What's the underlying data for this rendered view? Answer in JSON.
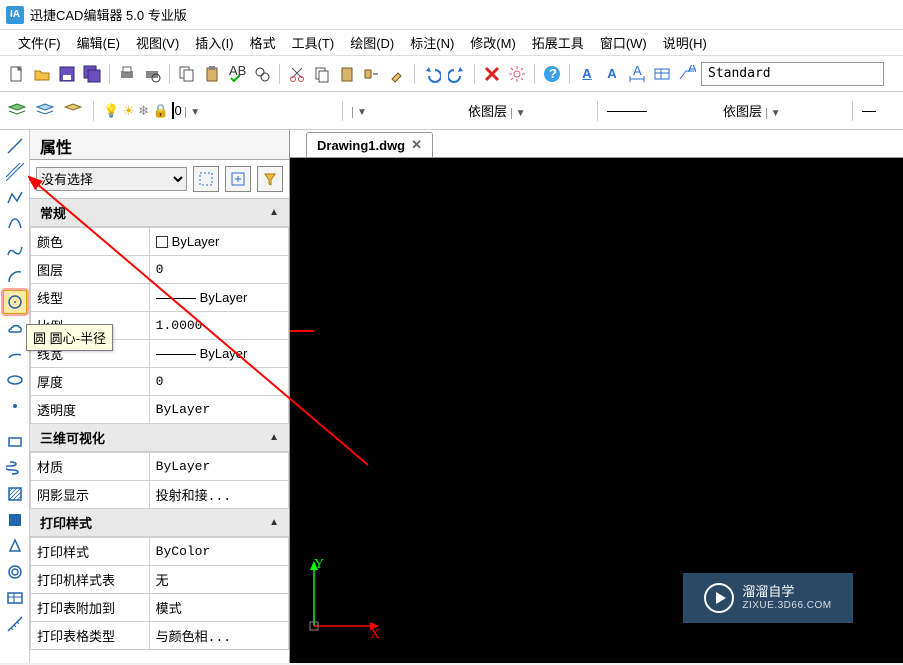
{
  "app": {
    "title": "迅捷CAD编辑器 5.0 专业版",
    "icon_text": "IA"
  },
  "menu": {
    "file": "文件(F)",
    "edit": "编辑(E)",
    "view": "视图(V)",
    "insert": "插入(I)",
    "format": "格式",
    "tools": "工具(T)",
    "draw": "绘图(D)",
    "dim": "标注(N)",
    "modify": "修改(M)",
    "ext": "拓展工具",
    "window": "窗口(W)",
    "help": "说明(H)"
  },
  "style_input": "Standard",
  "layer_row": {
    "layer_value": "0",
    "color_combo": "依图层",
    "linetype_combo": "依图层"
  },
  "tab": {
    "name": "Drawing1.dwg"
  },
  "props": {
    "panel_title": "属性",
    "selection": "没有选择",
    "sections": {
      "general": {
        "title": "常规",
        "rows": {
          "color": {
            "label": "颜色",
            "value": "ByLayer"
          },
          "layer": {
            "label": "图层",
            "value": "0"
          },
          "ltype": {
            "label": "线型",
            "value": "ByLayer"
          },
          "ltscale": {
            "label": "比例",
            "value": "1.0000"
          },
          "lweight": {
            "label": "线宽",
            "value": "ByLayer"
          },
          "thick": {
            "label": "厚度",
            "value": "0"
          },
          "transp": {
            "label": "透明度",
            "value": "ByLayer"
          }
        }
      },
      "viz3d": {
        "title": "三维可视化",
        "rows": {
          "material": {
            "label": "材质",
            "value": "ByLayer"
          },
          "shadow": {
            "label": "阴影显示",
            "value": "投射和接..."
          }
        }
      },
      "plot": {
        "title": "打印样式",
        "rows": {
          "pstyle": {
            "label": "打印样式",
            "value": "ByColor"
          },
          "ptable": {
            "label": "打印机样式表",
            "value": "无"
          },
          "pattach": {
            "label": "打印表附加到",
            "value": "模式"
          },
          "ptabtype": {
            "label": "打印表格类型",
            "value": "与颜色相..."
          }
        }
      }
    }
  },
  "tooltip": "圆 圆心-半径",
  "canvas_axes": {
    "x": "X",
    "y": "Y"
  },
  "watermark": {
    "brand": "溜溜自学",
    "sub": "ZIXUE.3D66.COM"
  }
}
